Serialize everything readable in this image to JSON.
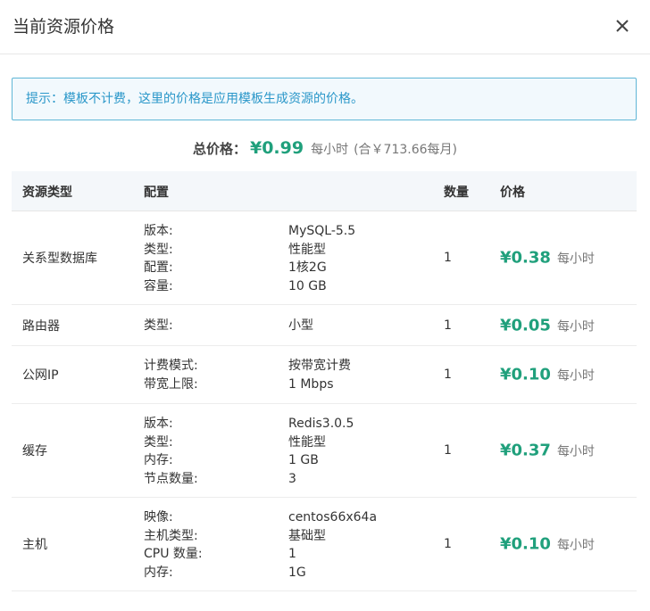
{
  "dialog": {
    "title": "当前资源价格",
    "close_icon": "close-icon"
  },
  "tip": "提示：模板不计费，这里的价格是应用模板生成资源的价格。",
  "total": {
    "label": "总价格：",
    "price": "¥0.99",
    "unit": "每小时",
    "monthly": "(合￥713.66每月)"
  },
  "table": {
    "headers": [
      "资源类型",
      "配置",
      "数量",
      "价格"
    ],
    "rows": [
      {
        "type": "关系型数据库",
        "config_labels": [
          "版本:",
          "类型:",
          "配置:",
          "容量:"
        ],
        "config_values": [
          "MySQL-5.5",
          "性能型",
          "1核2G",
          "10 GB"
        ],
        "qty": "1",
        "price": "¥0.38",
        "unit": "每小时"
      },
      {
        "type": "路由器",
        "config_labels": [
          "类型:"
        ],
        "config_values": [
          "小型"
        ],
        "qty": "1",
        "price": "¥0.05",
        "unit": "每小时"
      },
      {
        "type": "公网IP",
        "config_labels": [
          "计费模式:",
          "带宽上限:"
        ],
        "config_values": [
          "按带宽计费",
          "1 Mbps"
        ],
        "qty": "1",
        "price": "¥0.10",
        "unit": "每小时"
      },
      {
        "type": "缓存",
        "config_labels": [
          "版本:",
          "类型:",
          "内存:",
          "节点数量:"
        ],
        "config_values": [
          "Redis3.0.5",
          "性能型",
          "1 GB",
          "3"
        ],
        "qty": "1",
        "price": "¥0.37",
        "unit": "每小时"
      },
      {
        "type": "主机",
        "config_labels": [
          "映像:",
          "主机类型:",
          "CPU 数量:",
          "内存:"
        ],
        "config_values": [
          "centos66x64a",
          "基础型",
          "1",
          "1G"
        ],
        "qty": "1",
        "price": "¥0.10",
        "unit": "每小时"
      }
    ]
  }
}
